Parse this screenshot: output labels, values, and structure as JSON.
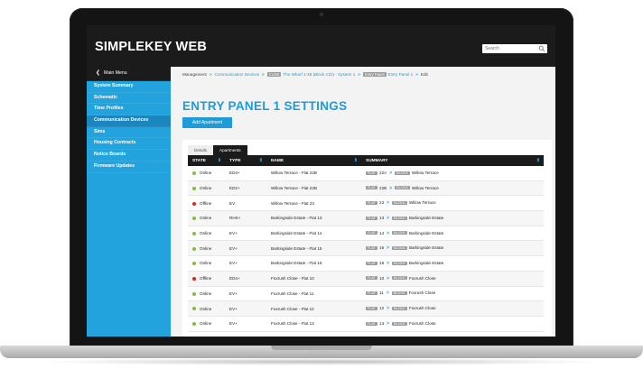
{
  "device": {
    "label": "MacBook"
  },
  "app": {
    "brand": "SIMPLEKEY WEB",
    "search_placeholder": "Search"
  },
  "colors": {
    "accent": "#1e9cd7",
    "sidebar": "#23a3dd",
    "dark": "#1b1b1b",
    "online": "#7cc042",
    "offline": "#e2231a"
  },
  "sidebar": {
    "back": "Main Menu",
    "items": [
      "System Summary",
      "Schematic",
      "Time Profiles",
      "Communication Devices",
      "Sims",
      "Housing Contracts",
      "Notice Boards",
      "Firmware Updates"
    ],
    "active_index": 3
  },
  "breadcrumb": {
    "root": "Management",
    "comm": "Communication Devices",
    "system_tag": "CLMS",
    "system": "The Wharf 1-38 (Block C/D) - System 1",
    "panel_tag": "Entry Panel",
    "panel": "Entry Panel 1",
    "current": "Edit"
  },
  "page": {
    "title": "ENTRY PANEL 1 SETTINGS",
    "add_button": "Add Apartment"
  },
  "tabs": [
    "Details",
    "Apartments"
  ],
  "table": {
    "headers": [
      "STATE",
      "TYPE",
      "NAME",
      "SUMMARY"
    ],
    "flat_tag": "FLAT",
    "block_tag": "BLOCK",
    "rows": [
      {
        "state": "Online",
        "type": "ED4+",
        "name": "Willow Terrace - Flat 22B",
        "flat": "22A",
        "block": "Willow Terrace"
      },
      {
        "state": "Online",
        "type": "ED2+",
        "name": "Willow Terrace - Flat 22B",
        "flat": "22B",
        "block": "Willow Terrace"
      },
      {
        "state": "Offline",
        "type": "EV",
        "name": "Willow Terrace - Flat 23",
        "flat": "23",
        "block": "Willow Terrace"
      },
      {
        "state": "Online",
        "type": "RHS+",
        "name": "Barkingside Estate - Flat 13",
        "flat": "13",
        "block": "Barkingside Estate"
      },
      {
        "state": "Online",
        "type": "EV+",
        "name": "Barkingside Estate - Flat 14",
        "flat": "14",
        "block": "Barkingside Estate"
      },
      {
        "state": "Online",
        "type": "EV+",
        "name": "Barkingside Estate - Flat 15",
        "flat": "15",
        "block": "Barkingside Estate"
      },
      {
        "state": "Online",
        "type": "EV+",
        "name": "Barkingside Estate - Flat 16",
        "flat": "16",
        "block": "Barkingside Estate"
      },
      {
        "state": "Offline",
        "type": "ED4+",
        "name": "Foxrush Close - Flat 10",
        "flat": "10",
        "block": "Foxrush Close"
      },
      {
        "state": "Online",
        "type": "EV+",
        "name": "Foxrush Close - Flat 11",
        "flat": "11",
        "block": "Foxrush Close"
      },
      {
        "state": "Online",
        "type": "EV+",
        "name": "Foxrush Close - Flat 12",
        "flat": "12",
        "block": "Foxrush Close"
      },
      {
        "state": "Online",
        "type": "EV+",
        "name": "Foxrush Close - Flat 13",
        "flat": "13",
        "block": "Foxrush Close"
      }
    ]
  }
}
